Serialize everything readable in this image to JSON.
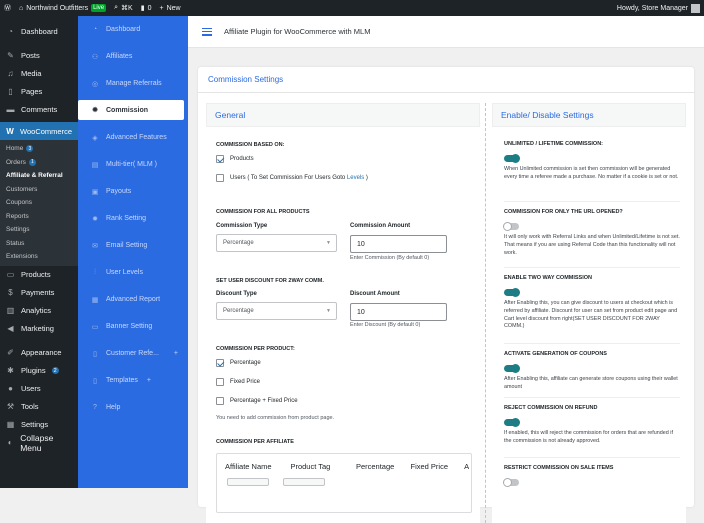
{
  "adminbar": {
    "site": "Northwind Outfitters",
    "live": "Live",
    "shortcut": "⌘K",
    "comments": "0",
    "new": "New",
    "howdy": "Howdy, Store Manager"
  },
  "wpmenu": {
    "dashboard": "Dashboard",
    "posts": "Posts",
    "media": "Media",
    "pages": "Pages",
    "comments": "Comments",
    "woocommerce": "WooCommerce",
    "woo_sub": {
      "home": "Home",
      "home_badge": "3",
      "orders": "Orders",
      "orders_badge": "1",
      "affiliate": "Affiliate & Referral",
      "customers": "Customers",
      "coupons": "Coupons",
      "reports": "Reports",
      "settings": "Settings",
      "status": "Status",
      "extensions": "Extensions"
    },
    "products": "Products",
    "payments": "Payments",
    "analytics": "Analytics",
    "marketing": "Marketing",
    "appearance": "Appearance",
    "plugins": "Plugins",
    "plugins_badge": "2",
    "users": "Users",
    "tools": "Tools",
    "settings": "Settings",
    "collapse": "Collapse Menu"
  },
  "plugin_nav": [
    "Dashboard",
    "Affiliates",
    "Manage Referrals",
    "Commission",
    "Advanced Features",
    "Multi-tier( MLM )",
    "Payouts",
    "Rank Setting",
    "Email Setting",
    "User Levels",
    "Advanced Report",
    "Banner Setting",
    "Customer Refe...",
    "Templates",
    "Help"
  ],
  "topbar": {
    "title": "Affiliate Plugin for WooCommerce with MLM"
  },
  "card": {
    "title": "Commission Settings"
  },
  "general": {
    "title": "General",
    "based_on": "COMMISSION BASED ON:",
    "products": "Products",
    "users_pre": "Users ( To Set Commission For Users Goto ",
    "users_link": "Levels",
    "users_post": " )",
    "all_products": "COMMISSION FOR ALL PRODUCTS",
    "type_label": "Commission Type",
    "type_value": "Percentage",
    "amount_label": "Commission Amount",
    "amount_value": "10",
    "amount_help": "Enter Commission (By default 0)",
    "user_discount": "SET USER DISCOUNT FOR 2WAY COMM.",
    "disc_type_label": "Discount Type",
    "disc_type_value": "Percentage",
    "disc_amount_label": "Discount Amount",
    "disc_amount_value": "10",
    "disc_help": "Enter Discount (By default 0)",
    "per_product": "COMMISSION PER PRODUCT:",
    "opt_percentage": "Percentage",
    "opt_fixed": "Fixed Price",
    "opt_both": "Percentage + Fixed Price",
    "per_product_note": "You need to add commission from product page.",
    "per_affiliate": "COMMISSION PER AFFILIATE",
    "table_headers": [
      "Affiliate Name",
      "Product Tag",
      "Percentage",
      "Fixed Price",
      "A"
    ]
  },
  "enable": {
    "title": "Enable/ Disable Settings",
    "items": [
      {
        "title": "UNLIMITED / LIFETIME COMMISSION:",
        "on": true,
        "desc": "When Unlimited commission is set then commission will be generated every time a referee made a purchase. No matter if a cookie is set or not."
      },
      {
        "title": "COMMISSION FOR ONLY THE URL OPENED?",
        "on": false,
        "desc": "It will only work with Referral Links and when Unlimited/Lifetime is not set. That means if you are using Referral Code than this functionality will not work."
      },
      {
        "title": "ENABLE TWO WAY COMMISSION",
        "on": true,
        "desc": "After Enabling this, you can give discount to users at checkout which is referred by affiliate. Discount for user can set from product edit page and Cart level discount from right(SET USER DISCOUNT FOR 2WAY COMM.)"
      },
      {
        "title": "ACTIVATE GENERATION OF COUPONS",
        "on": true,
        "desc": "After Enabling this, affiliate can generate store coupons using their wallet amount"
      },
      {
        "title": "REJECT COMMISSION ON REFUND",
        "on": true,
        "desc": "If enabled, this will reject the commission for orders that are refunded if the commission is not already approved."
      },
      {
        "title": "RESTRICT COMMISSION ON SALE ITEMS",
        "on": false,
        "desc": ""
      }
    ]
  }
}
